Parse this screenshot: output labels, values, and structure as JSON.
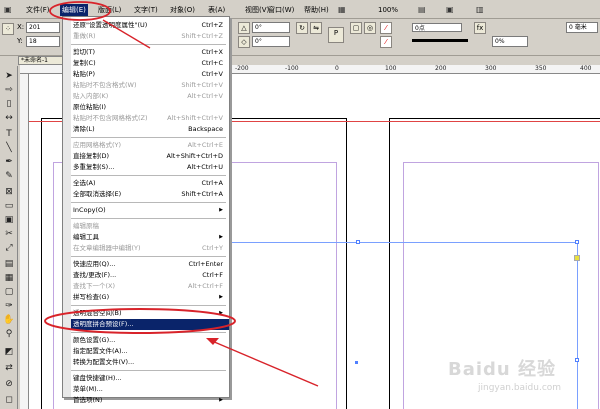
{
  "menubar": {
    "items": [
      "文件(F)",
      "编辑(E)",
      "版面(L)",
      "文字(T)",
      "对象(O)",
      "表(A)",
      "视图(V)",
      "窗口(W)",
      "帮助(H)"
    ],
    "zoom": "100%"
  },
  "control_panel": {
    "x_label": "X:",
    "x_value": "201",
    "y_label": "Y:",
    "y_value": "18",
    "angle1": "0°",
    "angle2": "0°",
    "stroke_pt": "0点",
    "opacity": "0%",
    "pt_label": "0 毫米"
  },
  "document": {
    "tab": "*未命名-1"
  },
  "ruler": {
    "numbers": [
      "-200",
      "-100",
      "0",
      "100",
      "200",
      "300",
      "350",
      "400"
    ]
  },
  "edit_menu": {
    "items": [
      {
        "label": "还原\"设置透明度属性\"(U)",
        "shortcut": "Ctrl+Z",
        "disabled": false
      },
      {
        "label": "重做(R)",
        "shortcut": "Shift+Ctrl+Z",
        "disabled": true
      },
      {
        "sep": true
      },
      {
        "label": "剪切(T)",
        "shortcut": "Ctrl+X",
        "disabled": false
      },
      {
        "label": "复制(C)",
        "shortcut": "Ctrl+C",
        "disabled": false
      },
      {
        "label": "粘贴(P)",
        "shortcut": "Ctrl+V",
        "disabled": false
      },
      {
        "label": "粘贴时不包含格式(W)",
        "shortcut": "Shift+Ctrl+V",
        "disabled": true
      },
      {
        "label": "贴入内部(K)",
        "shortcut": "Alt+Ctrl+V",
        "disabled": true
      },
      {
        "label": "原位粘贴(I)",
        "shortcut": "",
        "disabled": false
      },
      {
        "label": "粘贴时不包含网格格式(Z)",
        "shortcut": "Alt+Shift+Ctrl+V",
        "disabled": true
      },
      {
        "label": "清除(L)",
        "shortcut": "Backspace",
        "disabled": false
      },
      {
        "sep": true
      },
      {
        "label": "应用网格格式(Y)",
        "shortcut": "Alt+Ctrl+E",
        "disabled": true
      },
      {
        "label": "直接复制(D)",
        "shortcut": "Alt+Shift+Ctrl+D",
        "disabled": false
      },
      {
        "label": "多重复制(S)...",
        "shortcut": "Alt+Ctrl+U",
        "disabled": false
      },
      {
        "sep": true
      },
      {
        "label": "全选(A)",
        "shortcut": "Ctrl+A",
        "disabled": false
      },
      {
        "label": "全部取消选择(E)",
        "shortcut": "Shift+Ctrl+A",
        "disabled": false
      },
      {
        "sep": true
      },
      {
        "label": "InCopy(O)",
        "shortcut": "",
        "submenu": true,
        "disabled": false
      },
      {
        "sep": true
      },
      {
        "label": "编辑原稿",
        "shortcut": "",
        "disabled": true
      },
      {
        "label": "编辑工具",
        "shortcut": "",
        "submenu": true,
        "disabled": false
      },
      {
        "label": "在文章编辑器中编辑(Y)",
        "shortcut": "Ctrl+Y",
        "disabled": true
      },
      {
        "sep": true
      },
      {
        "label": "快速应用(Q)...",
        "shortcut": "Ctrl+Enter",
        "disabled": false
      },
      {
        "label": "查找/更改(F)...",
        "shortcut": "Ctrl+F",
        "disabled": false
      },
      {
        "label": "查找下一个(X)",
        "shortcut": "Alt+Ctrl+F",
        "disabled": true
      },
      {
        "label": "拼写检查(G)",
        "shortcut": "",
        "submenu": true,
        "disabled": false
      },
      {
        "sep": true
      },
      {
        "label": "透明混合空间(B)",
        "shortcut": "",
        "submenu": true,
        "disabled": false
      },
      {
        "label": "透明度拼合预设(F)...",
        "shortcut": "",
        "disabled": false,
        "highlighted": true
      },
      {
        "sep": true
      },
      {
        "label": "颜色设置(G)...",
        "shortcut": "",
        "disabled": false
      },
      {
        "label": "指定配置文件(A)...",
        "shortcut": "",
        "disabled": false
      },
      {
        "label": "转换为配置文件(V)...",
        "shortcut": "",
        "disabled": false
      },
      {
        "sep": true
      },
      {
        "label": "键盘快捷键(H)...",
        "shortcut": "",
        "disabled": false
      },
      {
        "label": "菜单(M)...",
        "shortcut": "",
        "disabled": false
      },
      {
        "label": "首选项(N)",
        "shortcut": "",
        "submenu": true,
        "disabled": false
      }
    ]
  },
  "watermark": {
    "logo": "Baidu 经验",
    "url": "jingyan.baidu.com"
  },
  "colors": {
    "highlight": "#0a246a",
    "annotation": "#d8232a"
  }
}
